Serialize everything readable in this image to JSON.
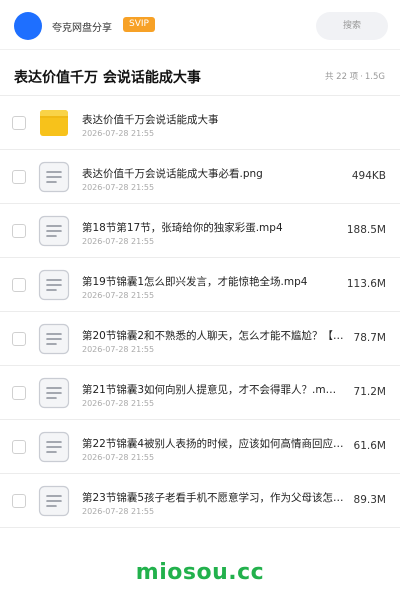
{
  "header": {
    "username": "夸克网盘分享",
    "badge": "SVIP",
    "search_placeholder": "搜索"
  },
  "folder": {
    "title": "表达价值千万 会说话能成大事",
    "count": "共 22 项",
    "separator": "·",
    "total_size": "1.5G"
  },
  "files": [
    {
      "type": "folder",
      "name": "表达价值千万会说话能成大事",
      "date": "2026-07-28 21:55",
      "size": ""
    },
    {
      "type": "file",
      "name": "表达价值千万会说话能成大事必看.png",
      "date": "2026-07-28 21:55",
      "size": "494KB"
    },
    {
      "type": "file",
      "name": "第18节第17节，张琦给你的独家彩蛋.mp4",
      "date": "2026-07-28 21:55",
      "size": "188.5M"
    },
    {
      "type": "file",
      "name": "第19节锦囊1怎么即兴发言，才能惊艳全场.mp4",
      "date": "2026-07-28 21:55",
      "size": "113.6M"
    },
    {
      "type": "file",
      "name": "第20节锦囊2和不熟悉的人聊天，怎么才能不尴尬？【…",
      "date": "2026-07-28 21:55",
      "size": "78.7M"
    },
    {
      "type": "file",
      "name": "第21节锦囊3如何向别人提意见，才不会得罪人？.m…",
      "date": "2026-07-28 21:55",
      "size": "71.2M"
    },
    {
      "type": "file",
      "name": "第22节锦囊4被别人表扬的时候，应该如何高情商回应…",
      "date": "2026-07-28 21:55",
      "size": "61.6M"
    },
    {
      "type": "file",
      "name": "第23节锦囊5孩子老看手机不愿意学习，作为父母该怎…",
      "date": "2026-07-28 21:55",
      "size": "89.3M"
    }
  ],
  "footer": {
    "watermark": "miosou.cc"
  },
  "colors": {
    "avatar": "#1e6fff",
    "badge": "#f7a126",
    "folder_icon": "#f7c21b",
    "watermark": "#22b14c"
  }
}
